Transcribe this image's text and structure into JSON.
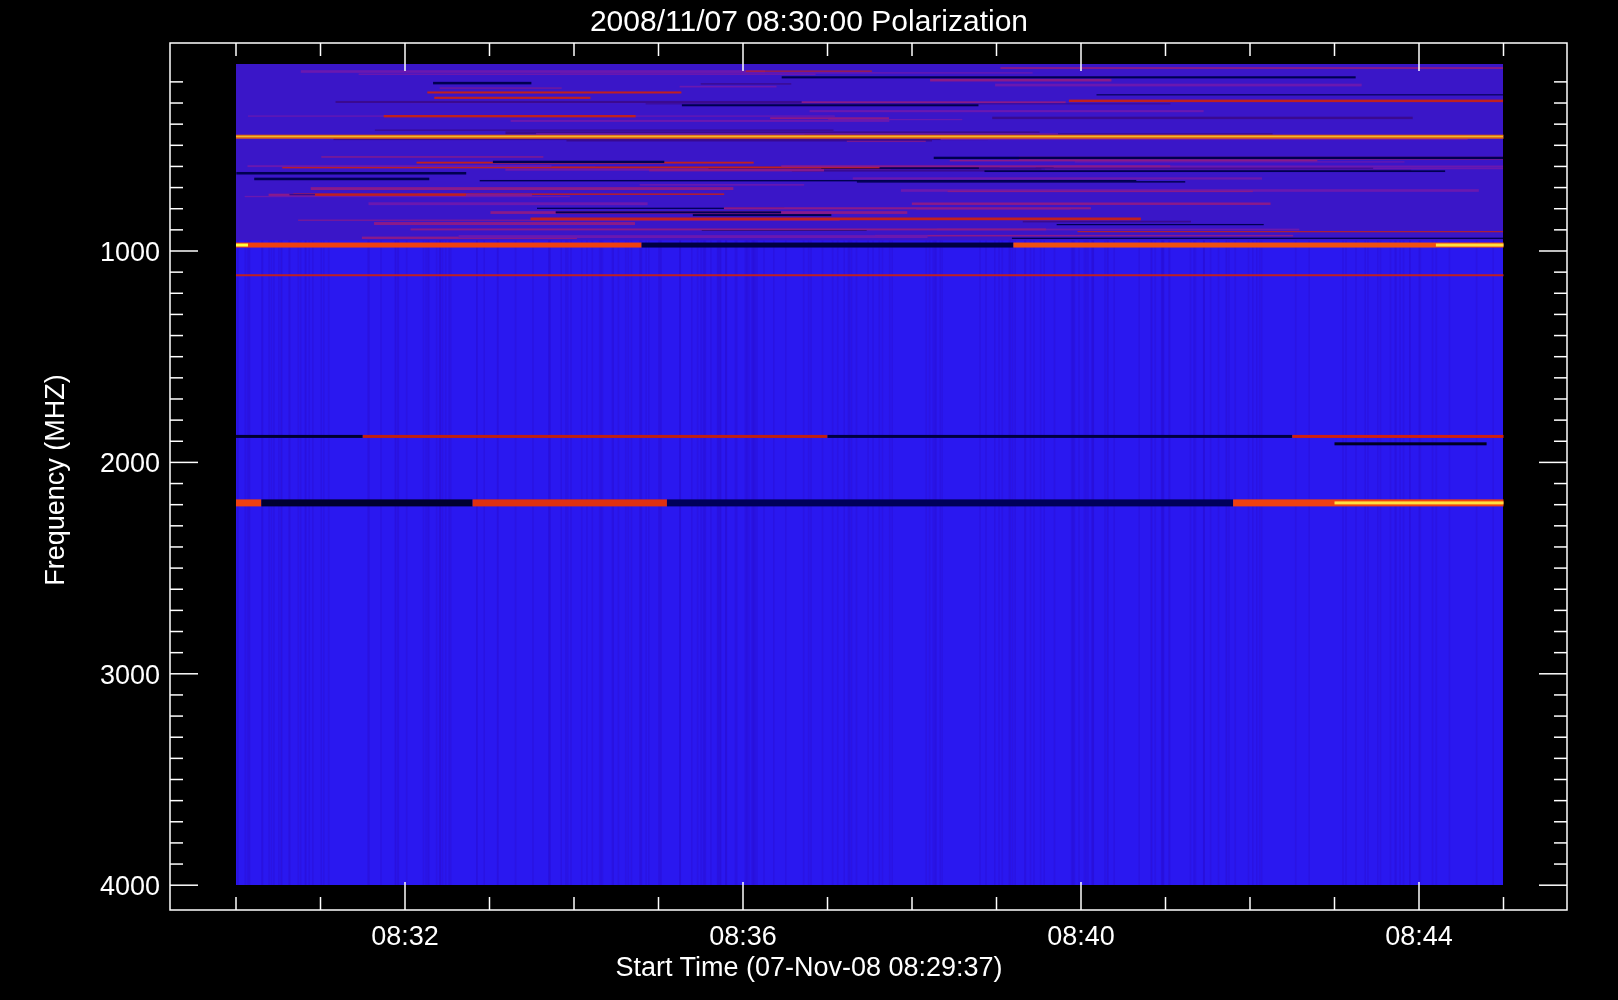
{
  "plot": {
    "title": "2008/11/07 08:30:00 Polarization",
    "ylabel": "Frequency (MHZ)",
    "xlabel": "Start Time (07-Nov-08 08:29:37)",
    "yticks": [
      "1000",
      "2000",
      "3000",
      "4000"
    ],
    "xticks": [
      "08:32",
      "08:36",
      "08:40",
      "08:44"
    ]
  }
}
